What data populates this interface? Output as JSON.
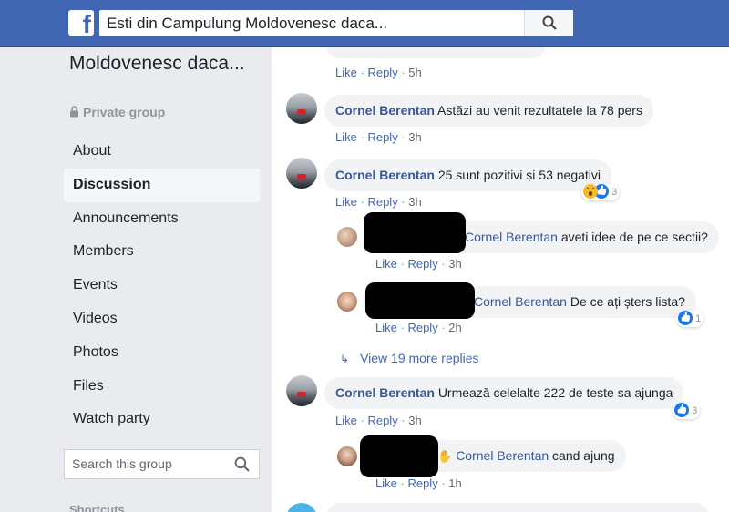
{
  "topbar": {
    "logo": "f",
    "search_value": "Esti din Campulung Moldovenesc daca...",
    "search_icon": "search-icon"
  },
  "group": {
    "name": "Moldovenesc daca...",
    "privacy": "Private group"
  },
  "nav": {
    "items": [
      "About",
      "Discussion",
      "Announcements",
      "Members",
      "Events",
      "Videos",
      "Photos",
      "Files",
      "Watch party"
    ],
    "active": "Discussion"
  },
  "group_search": {
    "placeholder": "Search this group"
  },
  "shortcuts_label": "Shortcuts",
  "actions": {
    "like": "Like",
    "reply": "Reply",
    "sep": "·"
  },
  "comments": [
    {
      "time": "5h"
    },
    {
      "author": "Cornel Berentan",
      "text": "Astăzi au venit rezultatele la 78 pers",
      "time": "3h"
    },
    {
      "author": "Cornel Berentan",
      "text": "25 sunt pozitivi și 53 negativi",
      "time": "3h",
      "reactions": "3"
    },
    {
      "mention": "Cornel Berentan",
      "text": "aveti idee de pe ce sectii?",
      "time": "3h"
    },
    {
      "mention": "Cornel Berentan",
      "text": "De ce ați șters lista?",
      "time": "2h",
      "reactions": "1"
    },
    {
      "author": "Cornel Berentan",
      "text": "Urmează celelalte 222 de teste sa ajunga",
      "time": "3h",
      "reactions": "3"
    },
    {
      "mention": "Cornel Berentan",
      "text": "cand ajung",
      "time": "1h"
    }
  ],
  "view_more": "View 19 more replies",
  "colors": {
    "brand": "#4267b2",
    "link": "#385898",
    "bubble": "#f2f3f5"
  }
}
